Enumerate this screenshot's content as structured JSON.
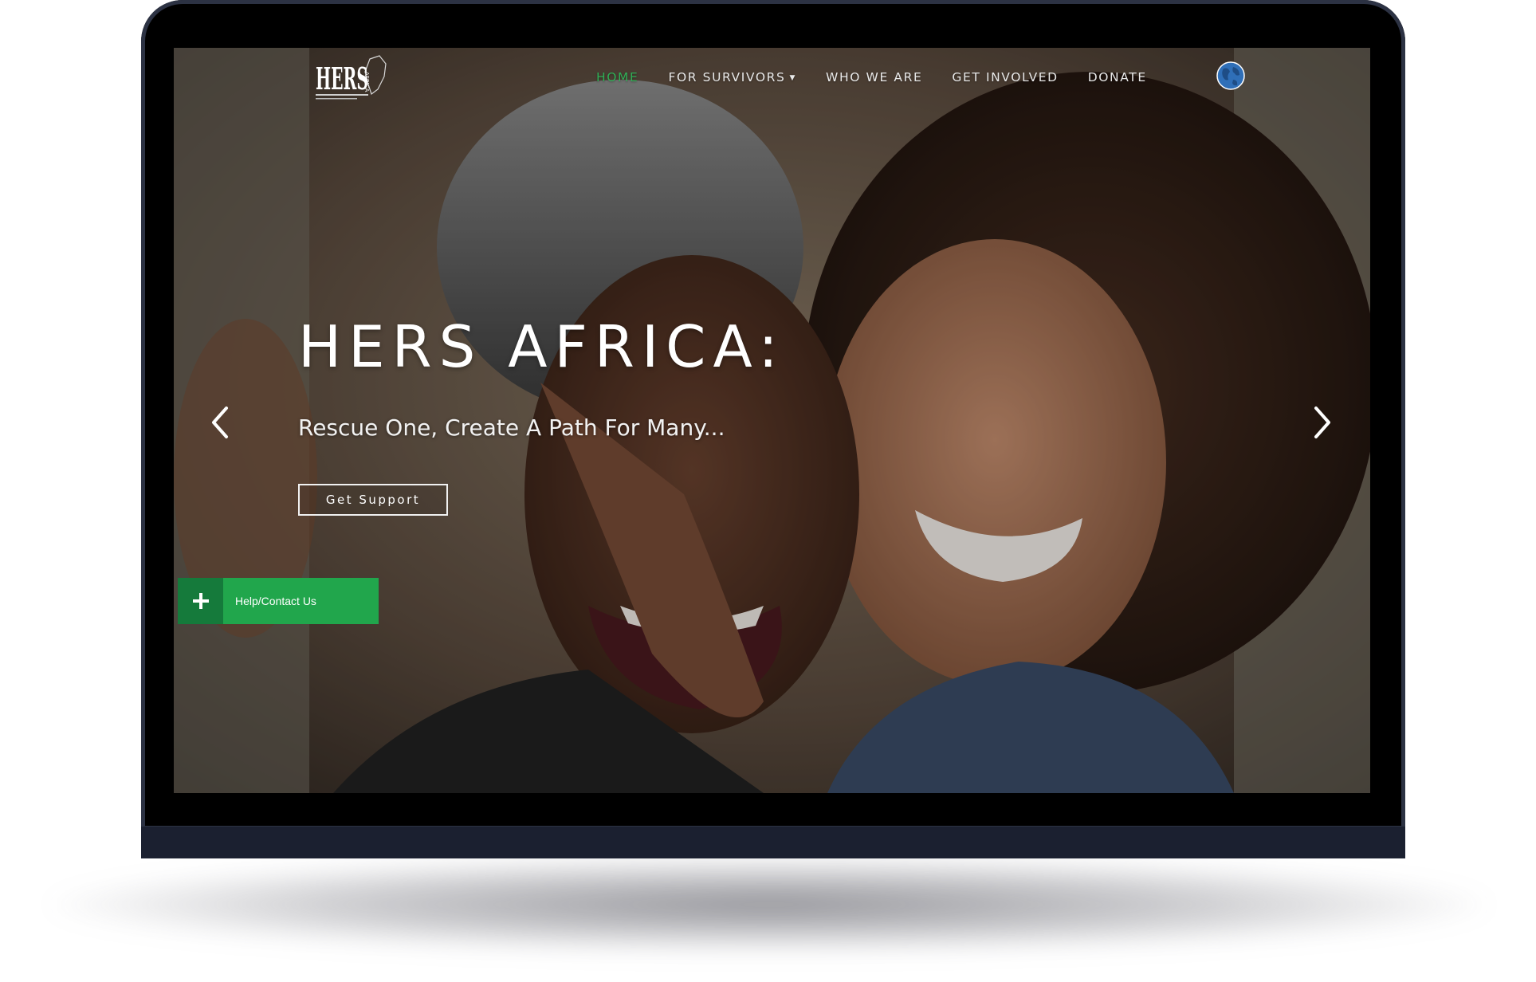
{
  "logo": {
    "wordmark": "HERS",
    "side_text": "AFRICA"
  },
  "nav": {
    "items": [
      {
        "label": "HOME",
        "active": true
      },
      {
        "label": "FOR SURVIVORS",
        "has_dropdown": true
      },
      {
        "label": "WHO WE ARE"
      },
      {
        "label": "GET INVOLVED"
      },
      {
        "label": "DONATE"
      }
    ],
    "language_icon": "globe-icon",
    "dropdown_icon": "caret-down-icon"
  },
  "hero": {
    "title": "HERS AFRICA:",
    "subtitle": "Rescue One, Create A Path For Many...",
    "cta_label": "Get Support",
    "prev_icon": "chevron-left-icon",
    "next_icon": "chevron-right-icon"
  },
  "help_widget": {
    "label": "Help/Contact Us",
    "icon": "plus-icon"
  },
  "colors": {
    "accent_green": "#21a64c",
    "active_nav": "#2fae56",
    "plus_bg": "#157a3b",
    "device_frame": "#2c3243"
  }
}
